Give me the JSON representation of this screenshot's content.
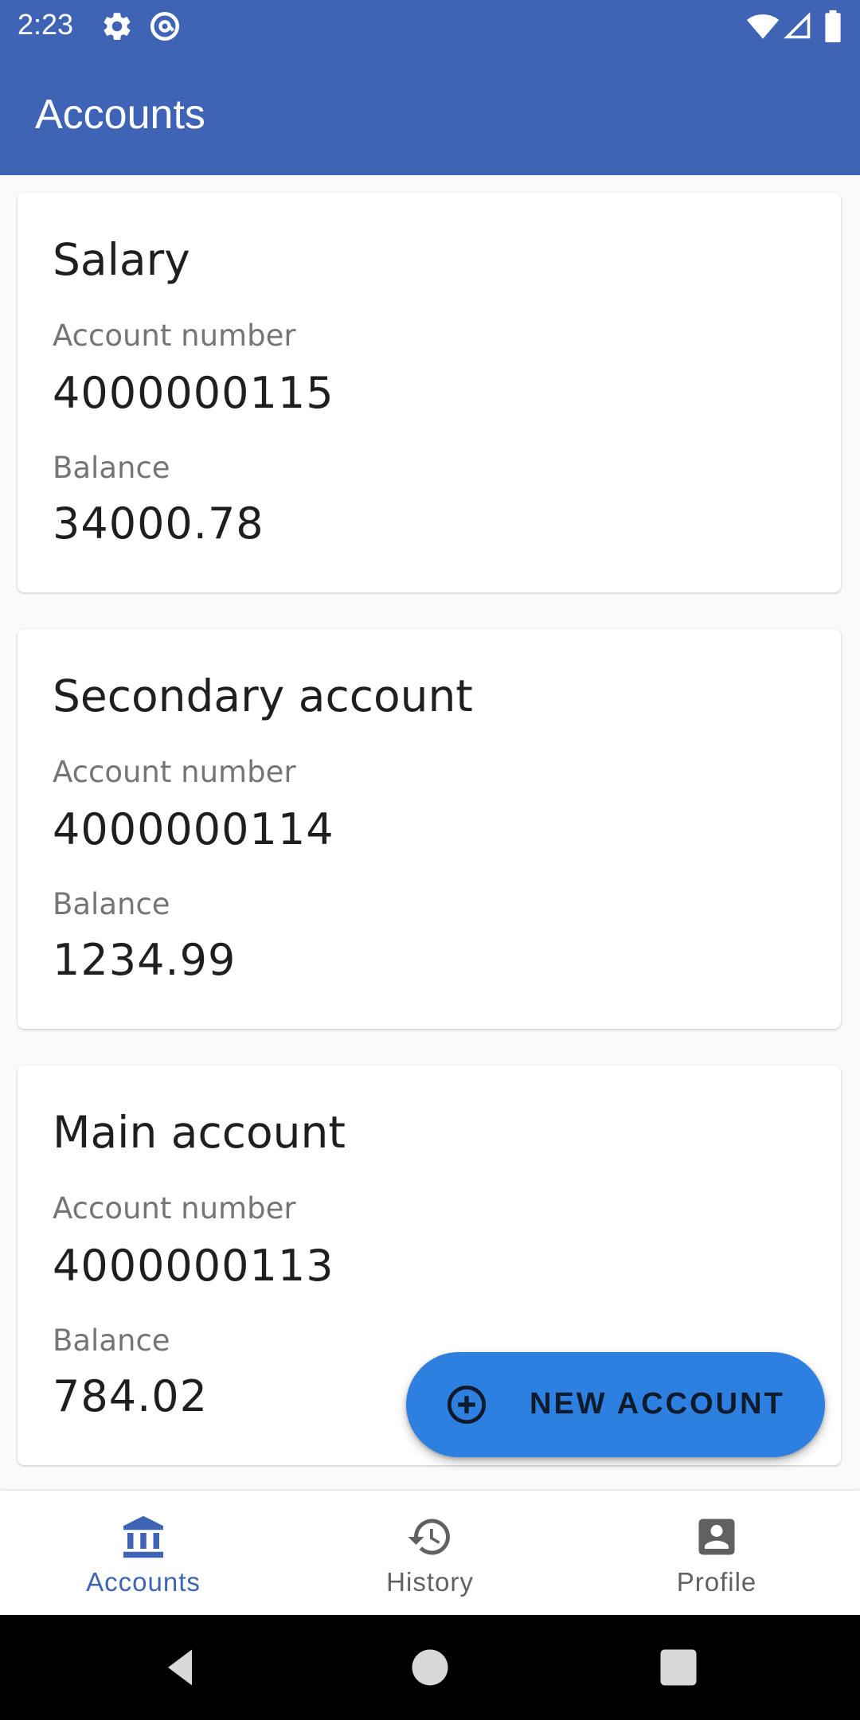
{
  "status_bar": {
    "time": "2:23",
    "icons": [
      "settings-gear-icon",
      "at-sign-icon",
      "wifi-icon",
      "cell-signal-icon",
      "battery-icon"
    ]
  },
  "app_bar": {
    "title": "Accounts",
    "color": "#3f64b5"
  },
  "accounts": [
    {
      "name": "Salary",
      "number_label": "Account number",
      "number": "4000000115",
      "balance_label": "Balance",
      "balance": "34000.78"
    },
    {
      "name": "Secondary account",
      "number_label": "Account number",
      "number": "4000000114",
      "balance_label": "Balance",
      "balance": "1234.99"
    },
    {
      "name": "Main account",
      "number_label": "Account number",
      "number": "4000000113",
      "balance_label": "Balance",
      "balance": "784.02"
    }
  ],
  "fab": {
    "label": "NEW ACCOUNT",
    "icon": "add-circle-icon",
    "color": "#2d7fe0"
  },
  "bottom_nav": {
    "items": [
      {
        "label": "Accounts",
        "icon": "bank-icon",
        "active": true
      },
      {
        "label": "History",
        "icon": "history-icon",
        "active": false
      },
      {
        "label": "Profile",
        "icon": "profile-icon",
        "active": false
      }
    ],
    "active_color": "#3f64b5",
    "inactive_color": "#616161"
  },
  "system_nav": {
    "buttons": [
      "back-icon",
      "home-icon",
      "recents-icon"
    ]
  }
}
